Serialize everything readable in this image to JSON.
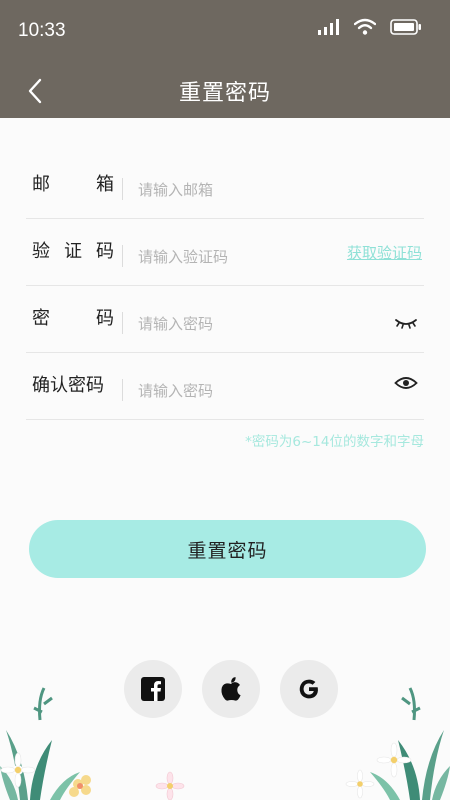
{
  "status_bar": {
    "time": "10:33"
  },
  "nav": {
    "title": "重置密码"
  },
  "form": {
    "email": {
      "label_chars": [
        "邮",
        "箱"
      ],
      "placeholder": "请输入邮箱"
    },
    "code": {
      "label_chars": [
        "验",
        "证",
        "码"
      ],
      "placeholder": "请输入验证码",
      "link": "获取验证码"
    },
    "password": {
      "label_chars": [
        "密",
        "码"
      ],
      "placeholder": "请输入密码"
    },
    "confirm": {
      "label": "确认密码",
      "placeholder": "请输入密码"
    },
    "hint": "*密码为6~14位的数字和字母"
  },
  "submit_label": "重置密码",
  "social": [
    "facebook",
    "apple",
    "google"
  ],
  "colors": {
    "header": "#6e6860",
    "accent": "#a7ebe4",
    "link": "#8fe1d7"
  }
}
